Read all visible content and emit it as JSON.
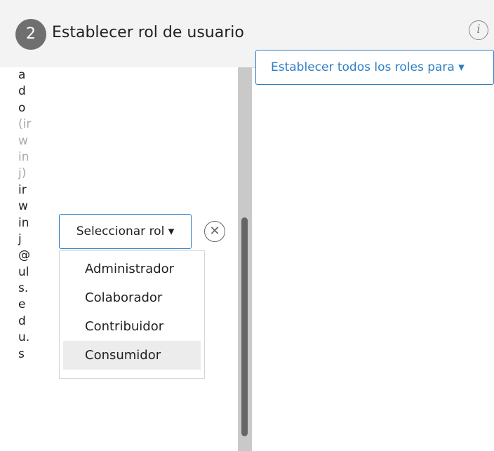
{
  "header": {
    "step_number": "2",
    "title": "Establecer rol de usuario",
    "info_icon": "info-icon"
  },
  "set_all_button": {
    "label": "Establecer todos los roles para ▾"
  },
  "user_entry": {
    "chars": [
      {
        "text": "a",
        "muted": false
      },
      {
        "text": "d",
        "muted": false
      },
      {
        "text": "o",
        "muted": false
      },
      {
        "text": "(ir",
        "muted": true
      },
      {
        "text": "w",
        "muted": true
      },
      {
        "text": "in",
        "muted": true
      },
      {
        "text": "j)",
        "muted": true
      },
      {
        "text": "ir",
        "muted": false
      },
      {
        "text": "w",
        "muted": false
      },
      {
        "text": "in",
        "muted": false
      },
      {
        "text": "j",
        "muted": false
      },
      {
        "text": "@",
        "muted": false
      },
      {
        "text": "ul",
        "muted": false
      },
      {
        "text": "s.",
        "muted": false
      },
      {
        "text": "e",
        "muted": false
      },
      {
        "text": "d",
        "muted": false
      },
      {
        "text": "u.",
        "muted": false
      },
      {
        "text": "s",
        "muted": false
      }
    ]
  },
  "role_select": {
    "label": "Seleccionar rol ▾",
    "options": [
      {
        "label": "Administrador",
        "highlighted": false
      },
      {
        "label": "Colaborador",
        "highlighted": false
      },
      {
        "label": "Contribuidor",
        "highlighted": false
      },
      {
        "label": "Consumidor",
        "highlighted": true
      }
    ]
  },
  "remove_icon": "remove-circle-x-icon",
  "colors": {
    "accent": "#2d7fc4",
    "header_bg": "#f3f3f3",
    "step_circle": "#6f6f6f",
    "option_highlight": "#ececec",
    "muted_text": "#a8a8a8"
  }
}
